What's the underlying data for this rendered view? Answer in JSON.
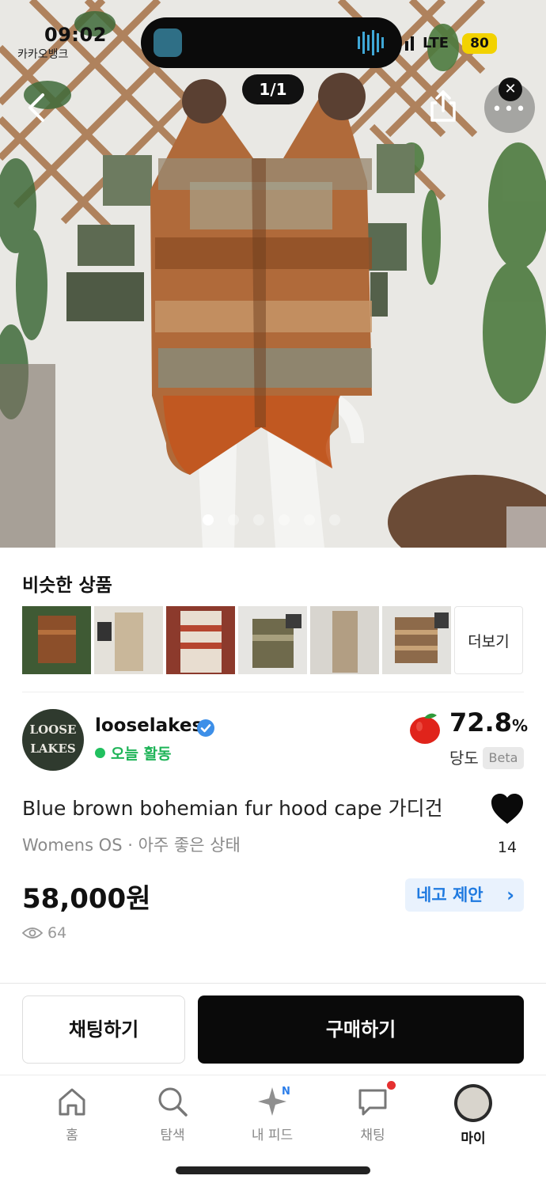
{
  "status_bar": {
    "time": "09:02",
    "back_app": "카카오뱅크",
    "network": "LTE",
    "battery": "80"
  },
  "viewer": {
    "counter": "1/1",
    "page_dots": 6,
    "active_dot": 0
  },
  "similar": {
    "title": "비슷한 상품",
    "more_label": "더보기"
  },
  "seller": {
    "avatar_text_line1": "LOOSE",
    "avatar_text_line2": "LAKES",
    "name": "looselakes",
    "activity": "오늘 활동",
    "score": "72.8",
    "score_unit": "%",
    "score_label": "당도",
    "score_badge": "Beta"
  },
  "product": {
    "title": "Blue brown bohemian fur hood cape 가디건",
    "meta": "Womens OS · 아주 좋은 상태",
    "likes": "14",
    "price": "58,000원",
    "offer_label": "네고 제안",
    "views": "64"
  },
  "actions": {
    "chat_label": "채팅하기",
    "buy_label": "구매하기"
  },
  "tabs": [
    {
      "label": "홈",
      "icon": "home-icon"
    },
    {
      "label": "탐색",
      "icon": "search-icon"
    },
    {
      "label": "내 피드",
      "icon": "sparkle-icon",
      "badge": "N"
    },
    {
      "label": "채팅",
      "icon": "chat-icon"
    },
    {
      "label": "마이",
      "icon": "profile-avatar"
    }
  ],
  "colors": {
    "active_green": "#21c05f",
    "offer_blue": "#1f7ae0",
    "buy_black": "#0a0a0a",
    "apple_red": "#e0241b"
  }
}
